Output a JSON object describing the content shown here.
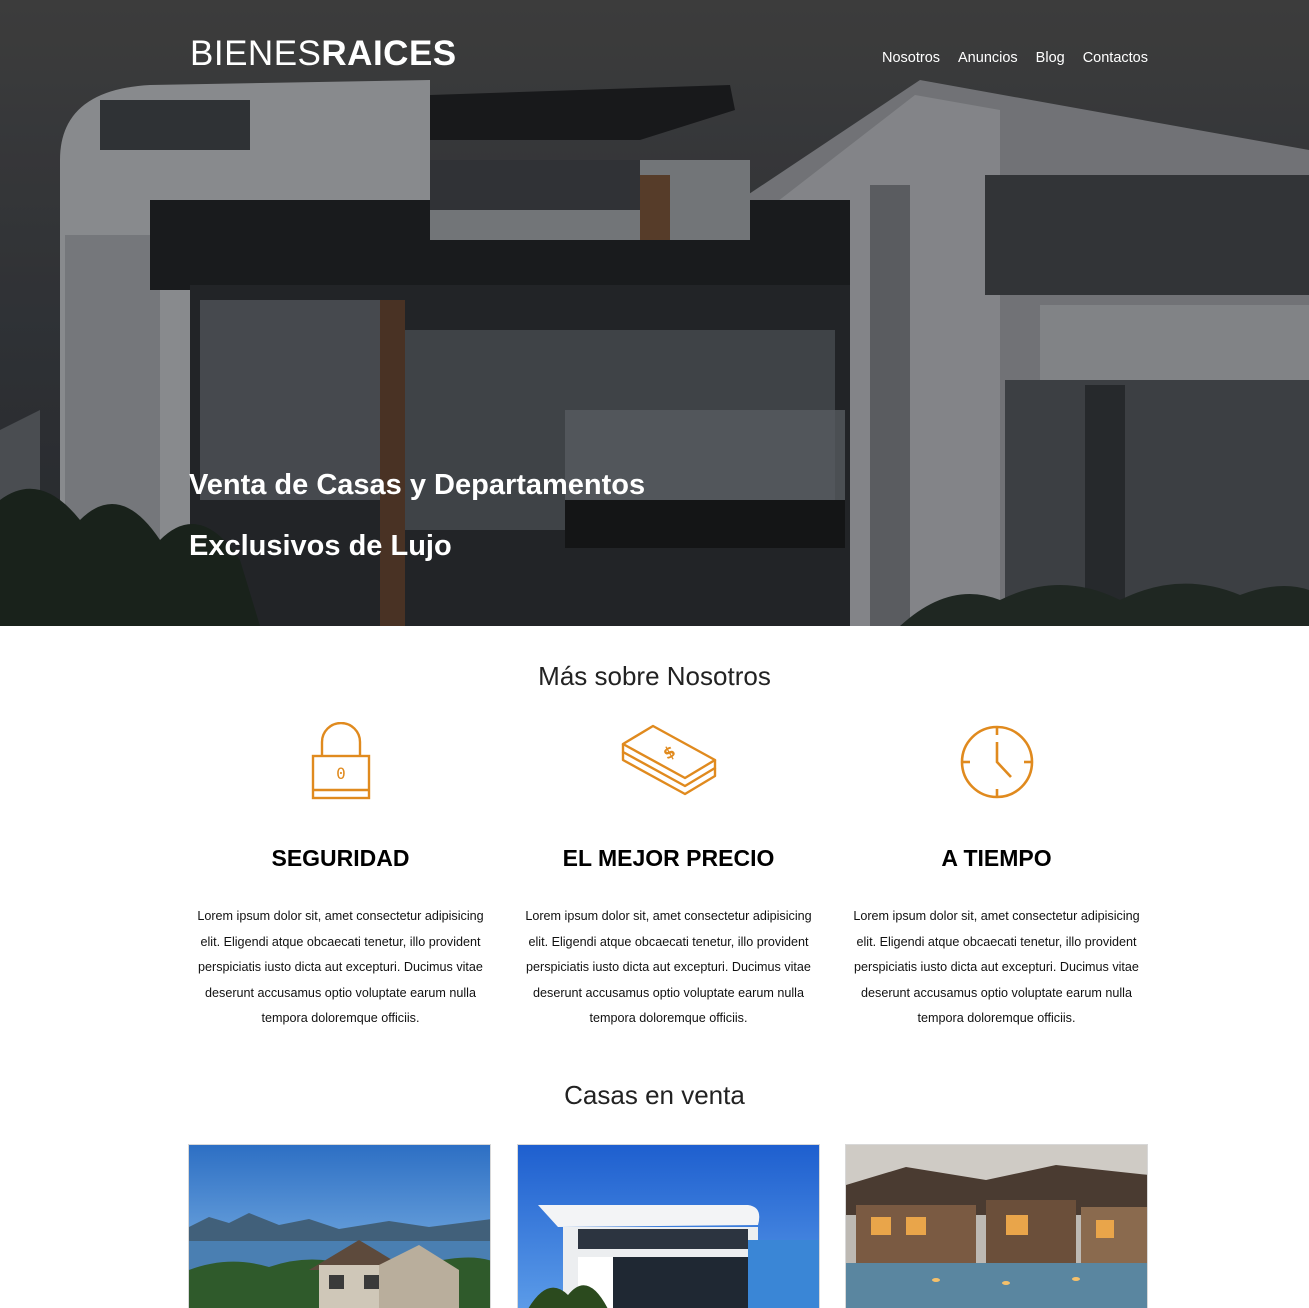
{
  "header": {
    "logo_light": "BIENES",
    "logo_bold": "RAICES",
    "nav": [
      {
        "label": "Nosotros"
      },
      {
        "label": "Anuncios"
      },
      {
        "label": "Blog"
      },
      {
        "label": "Contactos"
      }
    ]
  },
  "hero": {
    "title_line1": "Venta de Casas y Departamentos",
    "title_line2": "Exclusivos de Lujo"
  },
  "about": {
    "title": "Más sobre Nosotros",
    "accent_color": "#e08a1e",
    "features": [
      {
        "icon": "lock-icon",
        "title": "SEGURIDAD",
        "text": "Lorem ipsum dolor sit, amet consectetur adipisicing elit. Eligendi atque obcaecati tenetur, illo provident perspiciatis iusto dicta aut excepturi. Ducimus vitae deserunt accusamus optio voluptate earum nulla tempora doloremque officiis."
      },
      {
        "icon": "money-icon",
        "title": "EL MEJOR PRECIO",
        "text": "Lorem ipsum dolor sit, amet consectetur adipisicing elit. Eligendi atque obcaecati tenetur, illo provident perspiciatis iusto dicta aut excepturi. Ducimus vitae deserunt accusamus optio voluptate earum nulla tempora doloremque officiis."
      },
      {
        "icon": "clock-icon",
        "title": "A TIEMPO",
        "text": "Lorem ipsum dolor sit, amet consectetur adipisicing elit. Eligendi atque obcaecati tenetur, illo provident perspiciatis iusto dicta aut excepturi. Ducimus vitae deserunt accusamus optio voluptate earum nulla tempora doloremque officiis."
      }
    ]
  },
  "listings": {
    "title": "Casas en venta"
  }
}
